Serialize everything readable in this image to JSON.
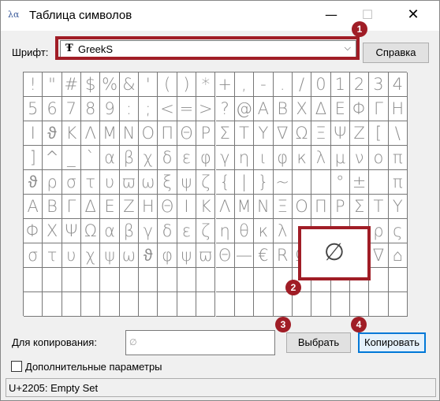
{
  "window": {
    "title": "Таблица символов",
    "app_icon": "charmap-icon",
    "minimize_glyph": "—",
    "maximize_glyph": "☐",
    "close_glyph": "✕"
  },
  "font": {
    "label": "Шрифт:",
    "selected": "GreekS",
    "font_icon_glyph": "Ŧ",
    "dropdown_glyph": "⌵"
  },
  "help_button": "Справка",
  "grid": {
    "rows": [
      [
        "!",
        "\"",
        "#",
        "$",
        "%",
        "&",
        "'",
        "(",
        ")",
        "*",
        "+",
        ",",
        "-",
        ".",
        "/",
        "0",
        "1",
        "2",
        "3",
        "4"
      ],
      [
        "5",
        "6",
        "7",
        "8",
        "9",
        ":",
        ";",
        "<",
        "=",
        ">",
        "?",
        "@",
        "A",
        "B",
        "X",
        "Δ",
        "E",
        "Φ",
        "Γ",
        "H"
      ],
      [
        "I",
        "ϑ",
        "K",
        "Λ",
        "M",
        "N",
        "O",
        "Π",
        "Θ",
        "P",
        "Σ",
        "T",
        "Υ",
        "∇",
        "Ω",
        "Ξ",
        "Ψ",
        "Z",
        "[",
        "\\"
      ],
      [
        "]",
        "^",
        "_",
        "`",
        "α",
        "β",
        "χ",
        "δ",
        "ε",
        "φ",
        "γ",
        "η",
        "ι",
        "φ",
        "κ",
        "λ",
        "μ",
        "ν",
        "ο",
        "π"
      ],
      [
        "ϑ",
        "ρ",
        "σ",
        "τ",
        "υ",
        "ϖ",
        "ω",
        "ξ",
        "ψ",
        "ζ",
        "{",
        "|",
        "}",
        "~",
        "",
        "",
        "°",
        "±",
        "",
        "π"
      ],
      [
        "A",
        "B",
        "Γ",
        "Δ",
        "E",
        "Z",
        "H",
        "Θ",
        "I",
        "K",
        "Λ",
        "M",
        "N",
        "Ξ",
        "O",
        "Π",
        "P",
        "Σ",
        "T",
        "Y"
      ],
      [
        "Φ",
        "X",
        "Ψ",
        "Ω",
        "α",
        "β",
        "γ",
        "δ",
        "ε",
        "ζ",
        "η",
        "θ",
        "κ",
        "λ",
        "μ",
        "",
        "",
        "",
        "ρ",
        "ς"
      ],
      [
        "σ",
        "τ",
        "υ",
        "χ",
        "ψ",
        "ω",
        "ϑ",
        "φ",
        "ψ",
        "ϖ",
        "Θ",
        "—",
        "€",
        "R",
        "Ω",
        "",
        "",
        "",
        "∇",
        "⌂"
      ],
      [
        "",
        "",
        "",
        "",
        "",
        "",
        "",
        "",
        "",
        "",
        "",
        "",
        "",
        "",
        "",
        "",
        "",
        "",
        "",
        ""
      ],
      [
        "",
        "",
        "",
        "",
        "",
        "",
        "",
        "",
        "",
        "",
        "",
        "",
        "",
        "",
        "",
        "",
        "",
        "",
        "",
        ""
      ]
    ],
    "zoomed_symbol": "∅"
  },
  "badges": [
    "1",
    "2",
    "3",
    "4"
  ],
  "copy": {
    "label": "Для копирования:",
    "value": "∅",
    "select_button": "Выбрать",
    "copy_button": "Копировать"
  },
  "advanced": {
    "label": "Дополнительные параметры",
    "checked": false
  },
  "status": "U+2205: Empty Set",
  "colors": {
    "highlight": "#a01d26",
    "focus_border": "#0078d7"
  }
}
